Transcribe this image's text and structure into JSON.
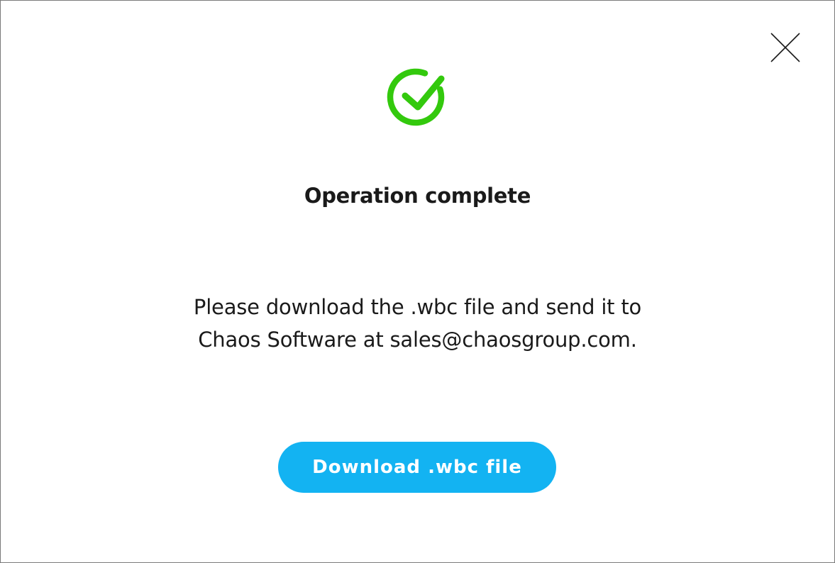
{
  "dialog": {
    "title": "Operation complete",
    "message_line1": "Please download the .wbc file and send it to",
    "message_line2": "Chaos Software at sales@chaosgroup.com.",
    "download_button_label": "Download .wbc file"
  },
  "icons": {
    "status": "check-circle-icon",
    "close": "close-icon"
  },
  "colors": {
    "success": "#33c90d",
    "accent": "#13b3f2",
    "text": "#1a1a1a"
  }
}
